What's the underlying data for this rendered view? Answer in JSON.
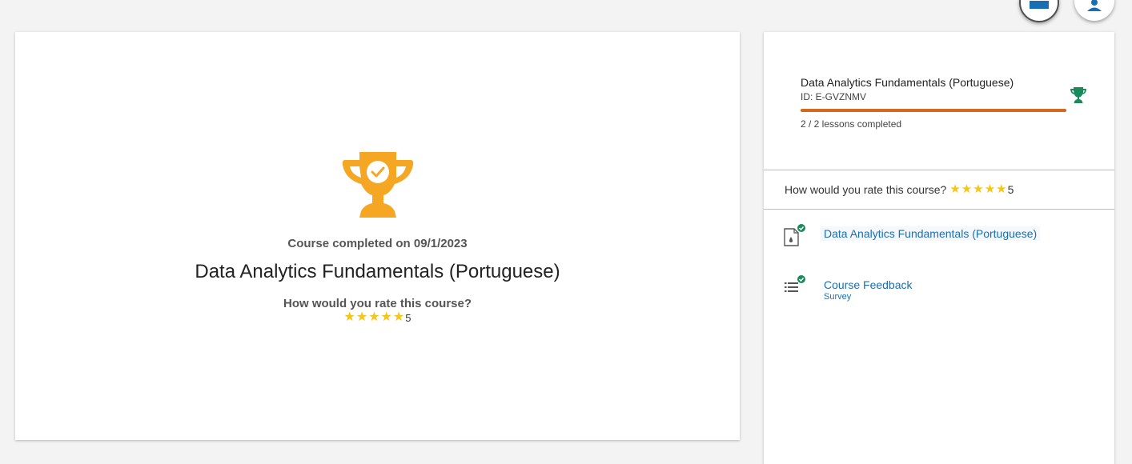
{
  "header": {
    "apps_icon": "apps-icon",
    "user_icon": "user-icon"
  },
  "main": {
    "trophy_icon": "trophy-check-icon",
    "completed_text": "Course completed on 09/1/2023",
    "course_title": "Data Analytics Fundamentals (Portuguese)",
    "rating_question": "How would you rate this course?",
    "rating_value": "5",
    "rating_stars": 5
  },
  "sidebar": {
    "course_title": "Data Analytics Fundamentals (Portuguese)",
    "course_id": "ID: E-GVZNMV",
    "progress": 1.0,
    "lessons_completed": "2 / 2 lessons completed",
    "trophy_icon": "trophy-icon",
    "rating_question": "How would you rate this course?",
    "rating_value": "5",
    "rating_stars": 5,
    "lessons": [
      {
        "title": "Data Analytics Fundamentals (Portuguese)",
        "subtitle": "",
        "icon": "document-icon",
        "status": "completed"
      },
      {
        "title": "Course Feedback",
        "subtitle": "Survey",
        "icon": "list-icon",
        "status": "completed"
      }
    ]
  },
  "colors": {
    "accent": "#1a6fb4",
    "trophy_main": "#f5a623",
    "trophy_side": "#1a8a5a",
    "progress": "#d2691e",
    "star": "#f5c518",
    "check": "#1a8a5a"
  }
}
